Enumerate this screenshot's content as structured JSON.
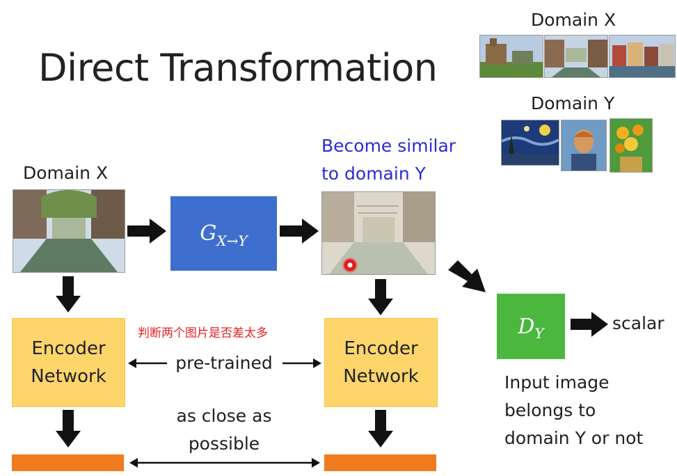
{
  "title": "Direct Transformation",
  "top_right": {
    "domain_x_label": "Domain X",
    "domain_y_label": "Domain Y"
  },
  "left": {
    "domain_x_label": "Domain X"
  },
  "generator": {
    "symbol": "G",
    "subscript": "X→Y"
  },
  "output_note": {
    "line1": "Become similar",
    "line2": "to domain Y"
  },
  "discriminator": {
    "symbol": "D",
    "subscript": "Y",
    "output_label": "scalar",
    "desc_line1": "Input image",
    "desc_line2": "belongs to",
    "desc_line3": "domain Y or not"
  },
  "encoder_left": {
    "line1": "Encoder",
    "line2": "Network"
  },
  "encoder_right": {
    "line1": "Encoder",
    "line2": "Network"
  },
  "middle": {
    "chinese_note": "判断两个图片是否差太多",
    "pretrained": "pre-trained",
    "close_line1": "as close as",
    "close_line2": "possible"
  },
  "colors": {
    "generator": "#3e6fcf",
    "discriminator": "#4bb73f",
    "encoder": "#fdd56a",
    "embedding": "#f07a1e",
    "note_blue": "#2b2bd8",
    "note_red": "#e52222"
  }
}
